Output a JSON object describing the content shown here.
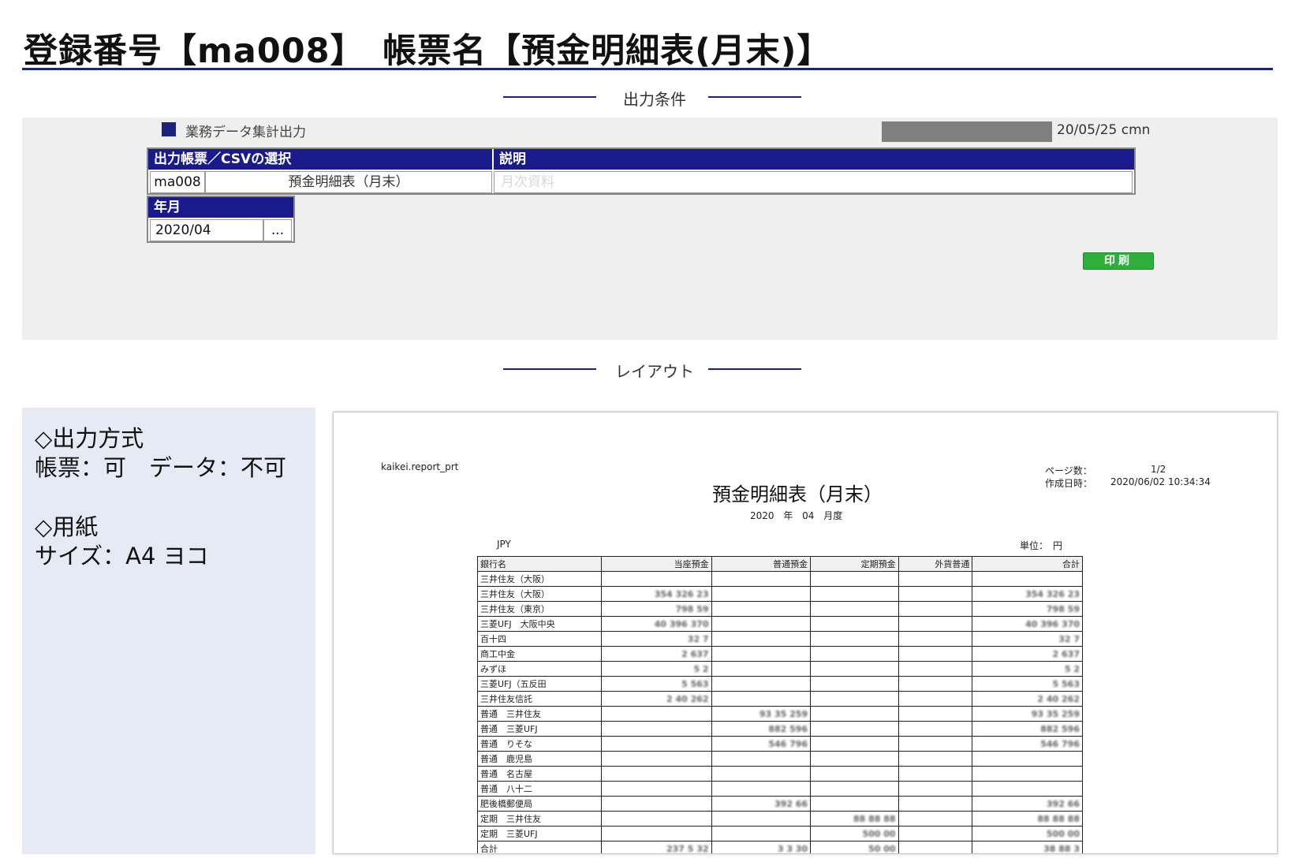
{
  "header": {
    "title": "登録番号【ma008】　帳票名【預金明細表(月末)】"
  },
  "sections": {
    "conditions": "出力条件",
    "layout": "レイアウト"
  },
  "conditions_panel": {
    "group_label": "業務データ集計出力",
    "date_user": "20/05/25 cmn",
    "select_table": {
      "col1_header": "出力帳票／CSVの選択",
      "col2_header": "説明",
      "code": "ma008",
      "name": "預金明細表（月末）",
      "description": "月次資料"
    },
    "year_month": {
      "header": "年月",
      "value": "2020/04",
      "picker_label": "..."
    },
    "print_button": "印刷"
  },
  "info": {
    "output_method_heading": "◇出力方式",
    "output_method_value": "帳票：可　データ：不可",
    "paper_heading": "◇用紙",
    "paper_value": "サイズ：A4 ヨコ"
  },
  "report": {
    "program_id": "kaikei.report_prt",
    "page_label": "ページ数：",
    "page_value": "1/2",
    "created_label": "作成日時：",
    "created_value": "2020/06/02 10:34:34",
    "title": "預金明細表（月末）",
    "subtitle": "2020 年 04 月度",
    "currency": "JPY",
    "unit_label": "単位：　円",
    "columns": [
      "銀行名",
      "当座預金",
      "普通預金",
      "定期預金",
      "外貨普通",
      "合計"
    ],
    "rows": [
      [
        "三井住友（大阪）",
        "",
        "",
        "",
        "",
        ""
      ],
      [
        "三井住友（大阪）",
        "354 326 23",
        "",
        "",
        "",
        "354 326 23"
      ],
      [
        "三井住友（東京）",
        "798 59",
        "",
        "",
        "",
        "798 59"
      ],
      [
        "三菱UFJ　大阪中央",
        "40 396 370",
        "",
        "",
        "",
        "40 396 370"
      ],
      [
        "百十四",
        "32 7",
        "",
        "",
        "",
        "32 7"
      ],
      [
        "商工中金",
        "2 637",
        "",
        "",
        "",
        "2 637"
      ],
      [
        "みずほ",
        "5 2",
        "",
        "",
        "",
        "5 2"
      ],
      [
        "三菱UFJ（五反田",
        "5 563",
        "",
        "",
        "",
        "5 563"
      ],
      [
        "三井住友信託",
        "2 40 262",
        "",
        "",
        "",
        "2 40 262"
      ],
      [
        "普通　三井住友",
        "",
        "93 35 259",
        "",
        "",
        "93 35 259"
      ],
      [
        "普通　三菱UFJ",
        "",
        "882 596",
        "",
        "",
        "882 596"
      ],
      [
        "普通　りそな",
        "",
        "546 796",
        "",
        "",
        "546 796"
      ],
      [
        "普通　鹿児島",
        "",
        "",
        "",
        "",
        ""
      ],
      [
        "普通　名古屋",
        "",
        "",
        "",
        "",
        ""
      ],
      [
        "普通　八十二",
        "",
        "",
        "",
        "",
        ""
      ],
      [
        "肥後橋郵便局",
        "",
        "392 66",
        "",
        "",
        "392 66"
      ],
      [
        "定期　三井住友",
        "",
        "",
        "88 88 88",
        "",
        "88 88 88"
      ],
      [
        "定期　三菱UFJ",
        "",
        "",
        "500 00",
        "",
        "500 00"
      ],
      [
        "合計",
        "237 5 32",
        "3 3 30",
        "50 00",
        "",
        "38 88 3"
      ]
    ]
  }
}
